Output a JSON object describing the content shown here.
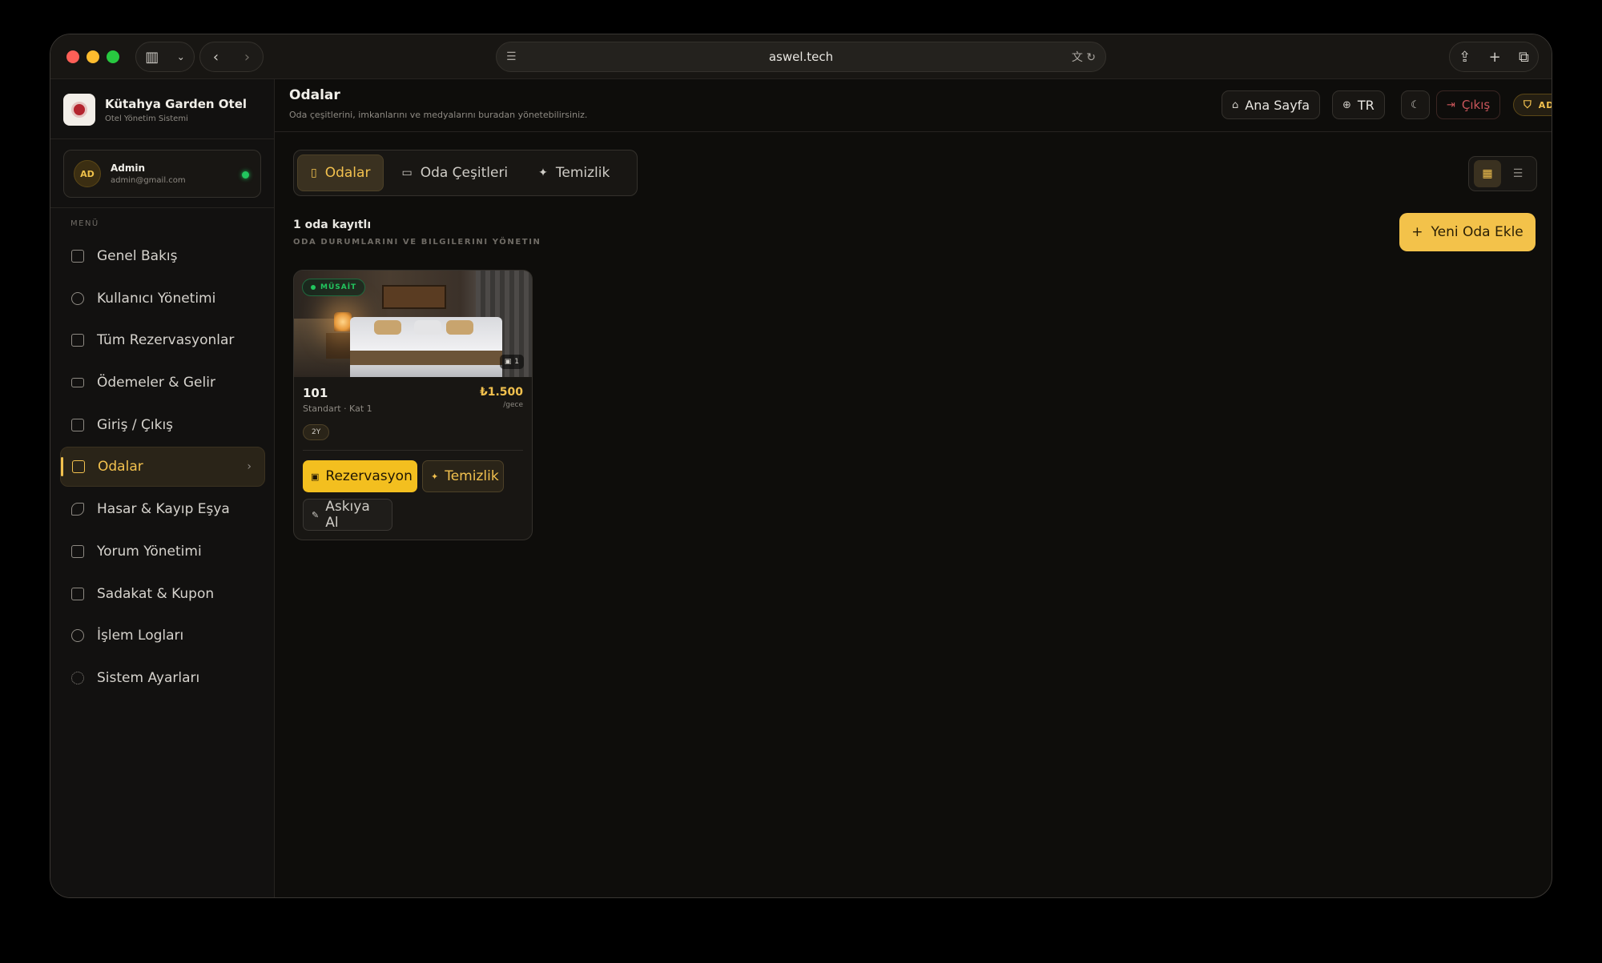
{
  "browser": {
    "url": "aswel.tech"
  },
  "brand": {
    "name": "Kütahya Garden Otel",
    "subtitle": "Otel Yönetim Sistemi"
  },
  "user": {
    "initials": "AD",
    "name": "Admin",
    "email": "admin@gmail.com",
    "status_color": "#22c55e"
  },
  "sidebar": {
    "menu_label": "MENÜ",
    "items": [
      {
        "label": "Genel Bakış",
        "icon": "grid-icon"
      },
      {
        "label": "Kullanıcı Yönetimi",
        "icon": "users-icon"
      },
      {
        "label": "Tüm Rezervasyonlar",
        "icon": "calendar-icon"
      },
      {
        "label": "Ödemeler & Gelir",
        "icon": "credit-card-icon"
      },
      {
        "label": "Giriş / Çıkış",
        "icon": "building-icon"
      },
      {
        "label": "Odalar",
        "icon": "hotel-icon",
        "active": true
      },
      {
        "label": "Hasar & Kayıp Eşya",
        "icon": "wrench-icon"
      },
      {
        "label": "Yorum Yönetimi",
        "icon": "message-icon"
      },
      {
        "label": "Sadakat & Kupon",
        "icon": "gift-icon"
      },
      {
        "label": "İşlem Logları",
        "icon": "history-icon"
      },
      {
        "label": "Sistem Ayarları",
        "icon": "gear-icon"
      }
    ]
  },
  "header": {
    "title": "Odalar",
    "subtitle": "Oda çeşitlerini, imkanlarını ve medyalarını buradan yönetebilirsiniz.",
    "home_label": "Ana Sayfa",
    "lang_label": "TR",
    "logout_label": "Çıkış",
    "role_badge": "ADMIN"
  },
  "tabs": [
    {
      "label": "Odalar",
      "active": true
    },
    {
      "label": "Oda Çeşitleri"
    },
    {
      "label": "Temizlik"
    }
  ],
  "summary": {
    "count_text": "1 oda kayıtlı",
    "subtext": "ODA DURUMLARINI VE BILGILERINI YÖNETIN",
    "add_button": "Yeni Oda Ekle"
  },
  "rooms": [
    {
      "status": "MÜSAİT",
      "image_count": "1",
      "number": "101",
      "type_floor": "Standart · Kat 1",
      "price": "₺1.500",
      "per": "/gece",
      "capacity": "2Y",
      "actions": {
        "reserve": "Rezervasyon",
        "clean": "Temizlik",
        "suspend": "Askıya Al"
      }
    }
  ],
  "colors": {
    "accent": "#f2c14e",
    "background": "#0e0d0b",
    "danger": "#c9555a",
    "success": "#22c55e"
  }
}
